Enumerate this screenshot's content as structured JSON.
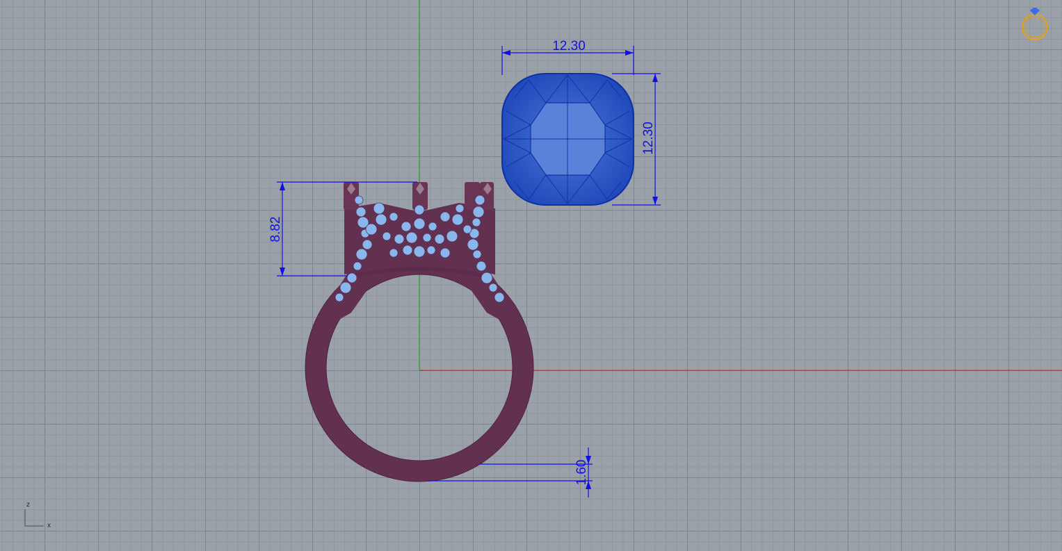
{
  "viewport": {
    "background_color": "#9ba1a8",
    "grid_major_color": "#7f858c",
    "grid_minor_color": "#8f959c",
    "x_axis_color": "#b53a3a",
    "y_axis_color": "#3aa03a"
  },
  "dimensions": {
    "stone_width": "12.30",
    "stone_height": "12.30",
    "head_height": "8.82",
    "shank_thickness": "1.60",
    "line_color": "#1010e6"
  },
  "model": {
    "ring_color": "#6a3555",
    "accent_stone_color": "#8ab6ee",
    "center_stone_color": "#2f5fc8"
  },
  "axis_gizmo": {
    "z_label": "z",
    "x_label": "x"
  },
  "corner_icon": "ring-logo-icon"
}
